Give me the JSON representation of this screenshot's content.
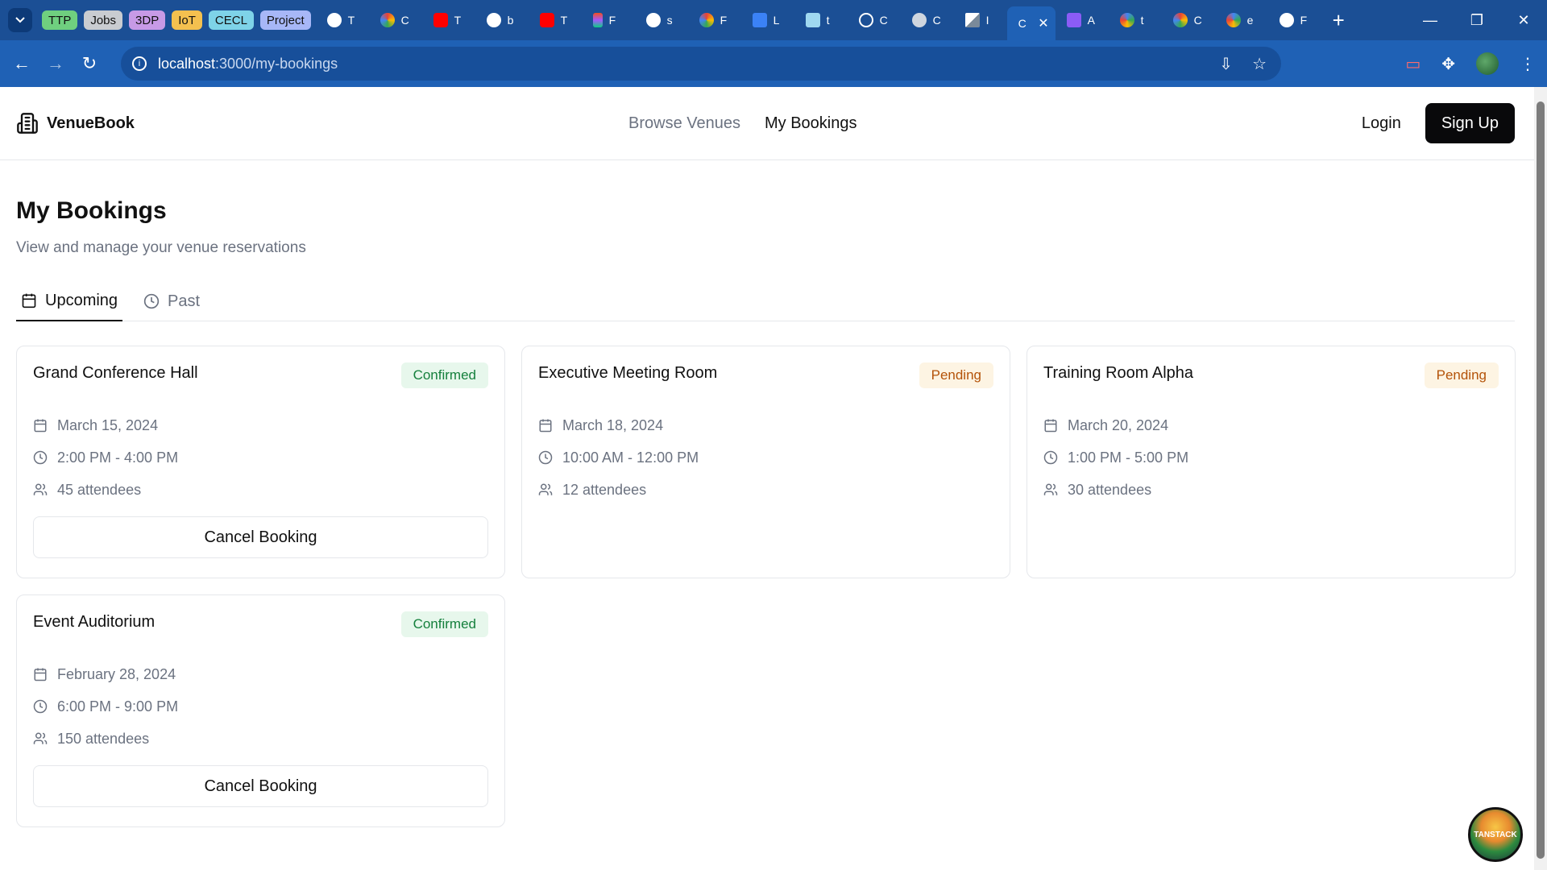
{
  "browser": {
    "tab_groups": [
      {
        "label": "TTP",
        "color": "#6fcf7f"
      },
      {
        "label": "Jobs",
        "color": "#c9ccd1"
      },
      {
        "label": "3DP",
        "color": "#c79ae6"
      },
      {
        "label": "IoT",
        "color": "#f4c04f"
      },
      {
        "label": "CECL",
        "color": "#7ed3e8"
      },
      {
        "label": "Project",
        "color": "#a7b7f7"
      }
    ],
    "tabs": [
      {
        "label": "T",
        "icon": "github-icon"
      },
      {
        "label": "C",
        "icon": "colorful-circle-icon"
      },
      {
        "label": "T",
        "icon": "youtube-icon"
      },
      {
        "label": "b",
        "icon": "github-icon"
      },
      {
        "label": "T",
        "icon": "youtube-icon"
      },
      {
        "label": "F",
        "icon": "figma-icon"
      },
      {
        "label": "s",
        "icon": "github-icon"
      },
      {
        "label": "F",
        "icon": "colorful-circle-icon"
      },
      {
        "label": "L",
        "icon": "gorm-icon"
      },
      {
        "label": "t",
        "icon": "notepad-icon"
      },
      {
        "label": "C",
        "icon": "openai-icon"
      },
      {
        "label": "C",
        "icon": "globe-icon"
      },
      {
        "label": "I",
        "icon": "mountain-icon"
      },
      {
        "label": "C",
        "icon": "active-tab",
        "active": true
      },
      {
        "label": "A",
        "icon": "app-icon"
      },
      {
        "label": "t",
        "icon": "google-icon"
      },
      {
        "label": "C",
        "icon": "colorful-circle-icon"
      },
      {
        "label": "e",
        "icon": "google-icon"
      },
      {
        "label": "F",
        "icon": "github-icon"
      }
    ],
    "url_host": "localhost",
    "url_path": ":3000/my-bookings"
  },
  "header": {
    "brand": "VenueBook",
    "nav": {
      "browse": "Browse Venues",
      "bookings": "My Bookings"
    },
    "login": "Login",
    "signup": "Sign Up"
  },
  "page": {
    "title": "My Bookings",
    "subtitle": "View and manage your venue reservations",
    "tabs": {
      "upcoming": "Upcoming",
      "past": "Past"
    }
  },
  "bookings": [
    {
      "name": "Grand Conference Hall",
      "status": "Confirmed",
      "date": "March 15, 2024",
      "time": "2:00 PM - 4:00 PM",
      "attendees": "45 attendees",
      "action": "Cancel Booking"
    },
    {
      "name": "Executive Meeting Room",
      "status": "Pending",
      "date": "March 18, 2024",
      "time": "10:00 AM - 12:00 PM",
      "attendees": "12 attendees"
    },
    {
      "name": "Training Room Alpha",
      "status": "Pending",
      "date": "March 20, 2024",
      "time": "1:00 PM - 5:00 PM",
      "attendees": "30 attendees"
    },
    {
      "name": "Event Auditorium",
      "status": "Confirmed",
      "date": "February 28, 2024",
      "time": "6:00 PM - 9:00 PM",
      "attendees": "150 attendees",
      "action": "Cancel Booking"
    }
  ],
  "devtools_badge": "TANSTACK"
}
